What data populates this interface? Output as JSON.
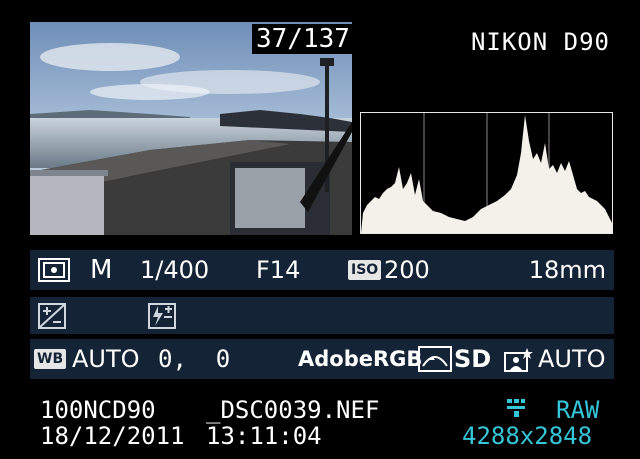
{
  "playback": {
    "frame_counter": "37/137",
    "camera_model": "NIKON D90"
  },
  "shooting_info": {
    "mode": "M",
    "shutter_speed": "1/400",
    "aperture": "F14",
    "iso_label": "ISO",
    "iso_value": "200",
    "focal_length": "18mm",
    "wb_label": "WB",
    "white_balance": "AUTO",
    "wb_fine_tune": "0,  0",
    "color_space": "AdobeRGB",
    "picture_control": "SD",
    "active_dlighting": "AUTO"
  },
  "file_info": {
    "folder": "100NCD90",
    "filename": "_DSC0039.NEF",
    "date": "18/12/2011",
    "time": "13:11:04",
    "quality": "RAW",
    "resolution": "4288x2848"
  },
  "colors": {
    "band": "#142436",
    "accent_cyan": "#35c6d9",
    "text": "#ffffff"
  },
  "icons": [
    "metering-matrix-icon",
    "exposure-compensation-icon",
    "flash-compensation-icon",
    "picture-control-icon",
    "active-dlighting-icon",
    "image-size-icon"
  ]
}
